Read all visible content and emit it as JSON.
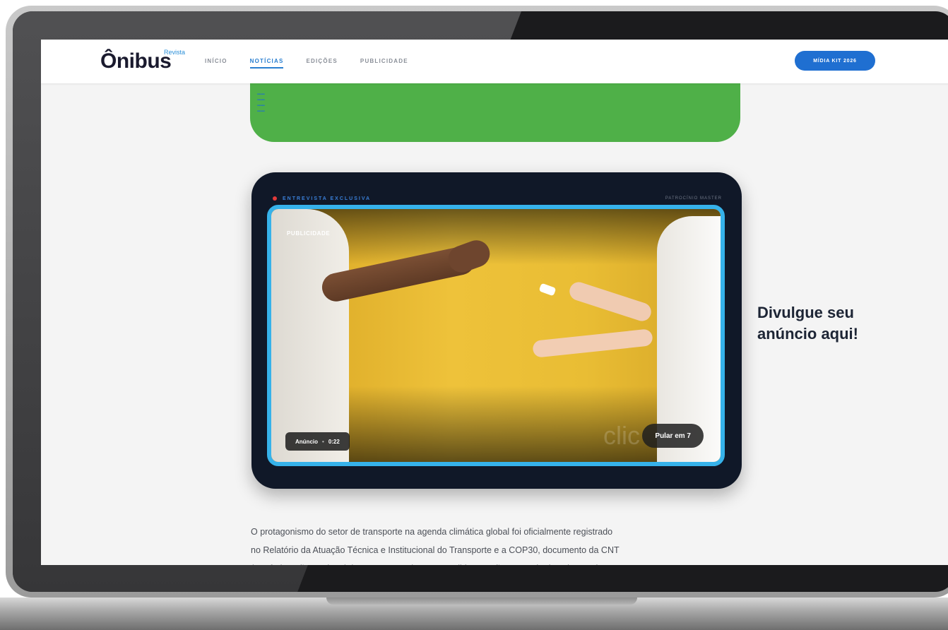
{
  "header": {
    "logo": "Ônibus",
    "logo_sub": "Revista",
    "nav": [
      "INÍCIO",
      "NOTÍCIAS",
      "EDIÇÕES",
      "PUBLICIDADE"
    ],
    "active_nav": "NOTÍCIAS",
    "media_kit_button": "MÍDIA KIT 2026"
  },
  "video_card": {
    "tag": "ENTREVISTA EXCLUSIVA",
    "sponsor": "PATROCÍNIO MASTER",
    "video_label": "PUBLICIDADE",
    "ad_label": "Anúncio",
    "ad_time": "0:22",
    "skip_label": "Pular em 7",
    "watermark": "clic"
  },
  "promo": {
    "line1": "Divulgue seu",
    "line2": "anúncio aqui!"
  },
  "article": {
    "line1": "O protagonismo do setor de transporte na agenda climática global foi oficialmente registrado",
    "line2": "no Relatório da Atuação Técnica e Institucional do Transporte e a COP30, documento da CNT",
    "line3": "(Confederação Nacional dos Transportes) que consolida as ações e resultados alcançados"
  },
  "colors": {
    "accent_blue": "#1f6fd1",
    "frame_cyan": "#36b2ea",
    "banner_green": "#4fb048",
    "card_navy": "#101828"
  }
}
